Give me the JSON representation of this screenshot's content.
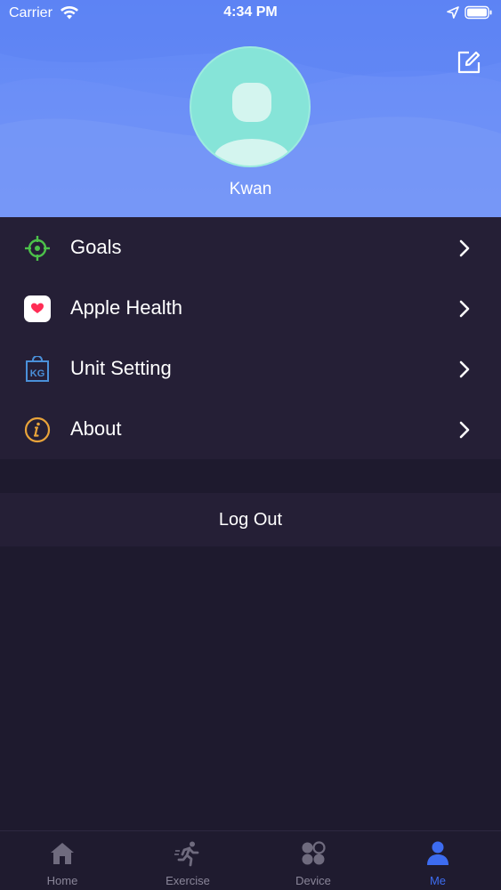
{
  "status_bar": {
    "carrier": "Carrier",
    "time": "4:34 PM",
    "icons": [
      "wifi-icon",
      "location-arrow-icon",
      "battery-icon"
    ]
  },
  "profile": {
    "username": "Kwan",
    "edit_icon": "edit-icon",
    "avatar_icon": "person-icon",
    "avatar_color": "#86e4d8"
  },
  "menu": {
    "items": [
      {
        "label": "Goals",
        "icon": "target-icon",
        "icon_color": "#4cc14a"
      },
      {
        "label": "Apple Health",
        "icon": "heart-icon",
        "icon_color": "#ff2d55"
      },
      {
        "label": "Unit Setting",
        "icon": "scale-kg-icon",
        "icon_color": "#4a90d9"
      },
      {
        "label": "About",
        "icon": "info-icon",
        "icon_color": "#e8a33a"
      }
    ]
  },
  "logout": {
    "label": "Log Out"
  },
  "tabbar": {
    "active": "Me",
    "active_color": "#3d6cf0",
    "tabs": [
      {
        "label": "Home",
        "icon": "home-icon"
      },
      {
        "label": "Exercise",
        "icon": "runner-icon"
      },
      {
        "label": "Device",
        "icon": "device-icon"
      },
      {
        "label": "Me",
        "icon": "person-icon"
      }
    ]
  },
  "colors": {
    "header_gradient": [
      "#5f86f5",
      "#7393f7"
    ],
    "background": "#1e1a2e",
    "panel": "#251f36"
  }
}
